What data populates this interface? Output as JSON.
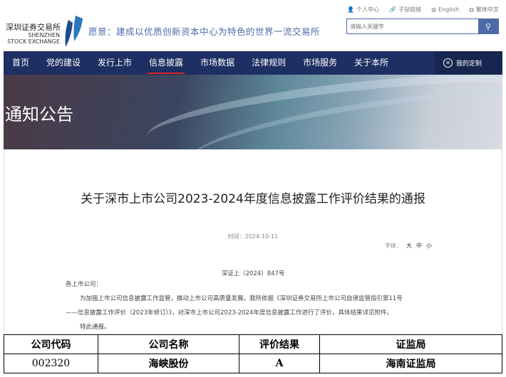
{
  "header": {
    "top_links": [
      "个人中心",
      "子站链接",
      "English",
      "繁体中文"
    ],
    "logo_cn": "深圳证券交易所",
    "logo_en": [
      "SHENZHEN",
      "STOCK EXCHANGE"
    ],
    "slogan": "愿景：建成以优质创新资本中心为特色的世界一流交易所",
    "search_placeholder": "请输入关键字"
  },
  "nav": {
    "items": [
      "首页",
      "党的建设",
      "发行上市",
      "信息披露",
      "市场数据",
      "法律规则",
      "市场服务",
      "关于本所"
    ],
    "active": 3,
    "custom": "我的定制"
  },
  "banner": {
    "title": "通知公告"
  },
  "article": {
    "title": "关于深市上市公司2023-2024年度信息披露工作评价结果的通报",
    "time": "时间：2024-10-11",
    "font_label": "字体：",
    "font_sizes": [
      "大",
      "中",
      "小"
    ],
    "doc_no": "深证上〔2024〕847号",
    "salutation": "各上市公司：",
    "body1": "为加强上市公司信息披露工作监管，推动上市公司高质量发展，我所依据《深圳证券交易所上市公司自律监管指引第11号",
    "body2": "——信息披露工作评价（2023年修订）》，对深市上市公司2023-2024年度信息披露工作进行了评价，具体结果详见附件。",
    "closing": "特此通报。"
  },
  "table": {
    "headers": [
      "公司代码",
      "公司名称",
      "评价结果",
      "证监局"
    ],
    "rows": [
      [
        "002320",
        "海峡股份",
        "A",
        "海南证监局"
      ]
    ]
  }
}
